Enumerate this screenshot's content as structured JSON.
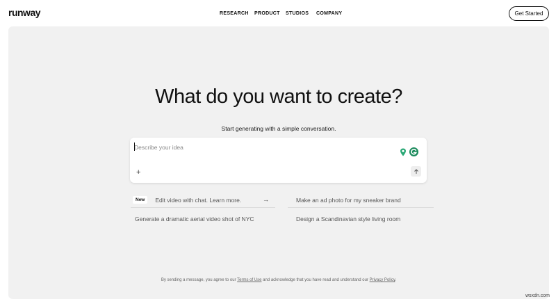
{
  "brand": "runway",
  "nav": [
    "RESEARCH",
    "PRODUCT",
    "STUDIOS",
    "COMPANY"
  ],
  "cta_label": "Get Started",
  "hero": {
    "title": "What do you want to create?",
    "subtitle": "Start generating with a simple conversation."
  },
  "prompt": {
    "placeholder": "Describe your idea",
    "add_icon": "plus-icon",
    "send_icon": "arrow-up-icon",
    "extensions": [
      "location-pin-icon",
      "grammarly-icon"
    ]
  },
  "suggestions": {
    "badge": "New",
    "item1": "Edit video with chat. Learn more.",
    "item2": "Make an ad photo for my sneaker brand",
    "item3": "Generate a dramatic aerial video shot of NYC",
    "item4": "Design a Scandinavian style living room"
  },
  "footer": {
    "pre": "By sending a message, you agree to our ",
    "terms": "Terms of Use",
    "mid": " and acknowledge that you have read and understand our ",
    "privacy": "Privacy Policy",
    "post": "."
  },
  "watermark": "wsxdn.com",
  "colors": {
    "background": "#f1f1f1",
    "accent": "#1a8a5b"
  }
}
